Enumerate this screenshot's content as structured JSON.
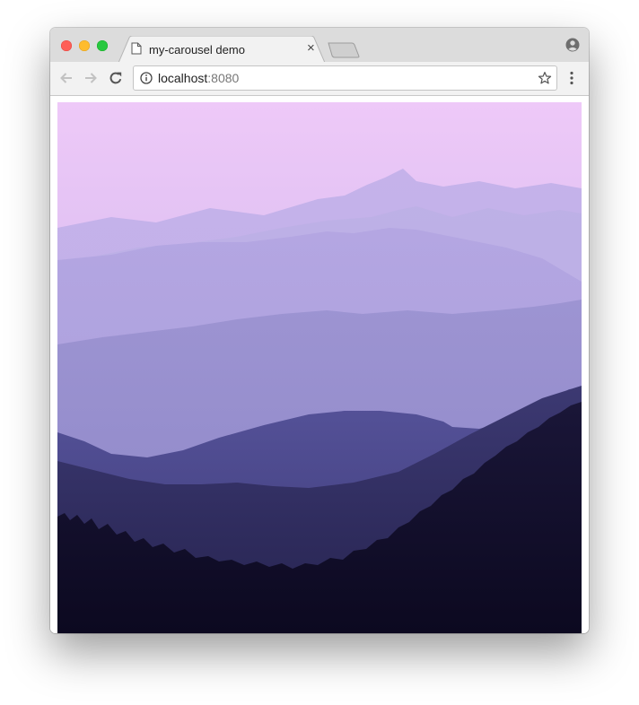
{
  "browser": {
    "tab_title": "my-carousel demo",
    "tab_close": "×",
    "address": {
      "host": "localhost",
      "port": ":8080"
    }
  },
  "icons": {
    "page": "page-icon",
    "close": "close-icon",
    "new_tab": "new-tab-icon",
    "profile": "profile-icon",
    "back": "back-arrow-icon",
    "forward": "forward-arrow-icon",
    "reload": "reload-icon",
    "info": "info-icon",
    "bookmark": "star-icon",
    "menu": "kebab-menu-icon"
  },
  "carousel": {
    "slide_subject": "misty purple mountain ridges"
  },
  "colors": {
    "sky": "#eec9f8",
    "ridge_light": "#b0a4dc",
    "ridge_mid": "#4c4a86",
    "ridge_dark": "#0d0a24"
  }
}
